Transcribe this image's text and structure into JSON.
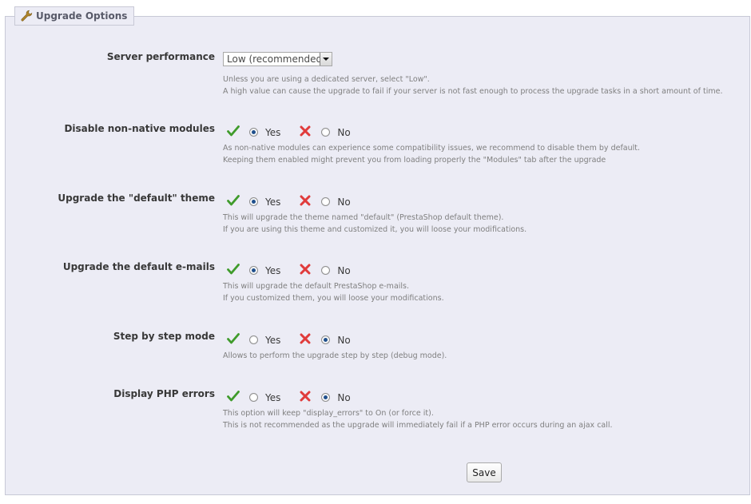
{
  "section": {
    "title": "Upgrade Options",
    "icon": "wrench-icon"
  },
  "colors": {
    "panel_bg": "#ececf5",
    "check": "#3f9b2b",
    "cross": "#e03b3b",
    "radio_selected": "#1f4f8c"
  },
  "server_performance": {
    "label": "Server performance",
    "selected": "Low (recommended)",
    "desc1": "Unless you are using a dedicated server, select \"Low\".",
    "desc2": "A high value can cause the upgrade to fail if your server is not fast enough to process the upgrade tasks in a short amount of time."
  },
  "options": [
    {
      "label": "Disable non-native modules",
      "yes": "Yes",
      "no": "No",
      "value": "yes",
      "desc1": "As non-native modules can experience some compatibility issues, we recommend to disable them by default.",
      "desc2": "Keeping them enabled might prevent you from loading properly the \"Modules\" tab after the upgrade"
    },
    {
      "label": "Upgrade the \"default\" theme",
      "yes": "Yes",
      "no": "No",
      "value": "yes",
      "desc1": "This will upgrade the theme named \"default\" (PrestaShop default theme).",
      "desc2": "If you are using this theme and customized it, you will loose your modifications."
    },
    {
      "label": "Upgrade the default e-mails",
      "yes": "Yes",
      "no": "No",
      "value": "yes",
      "desc1": "This will upgrade the default PrestaShop e-mails.",
      "desc2": "If you customized them, you will loose your modifications."
    },
    {
      "label": "Step by step mode",
      "yes": "Yes",
      "no": "No",
      "value": "no",
      "desc1": "Allows to perform the upgrade step by step (debug mode).",
      "desc2": ""
    },
    {
      "label": "Display PHP errors",
      "yes": "Yes",
      "no": "No",
      "value": "no",
      "desc1": "This option will keep \"display_errors\" to On (or force it).",
      "desc2": "This is not recommended as the upgrade will immediately fail if a PHP error occurs during an ajax call."
    }
  ],
  "save_label": "Save"
}
